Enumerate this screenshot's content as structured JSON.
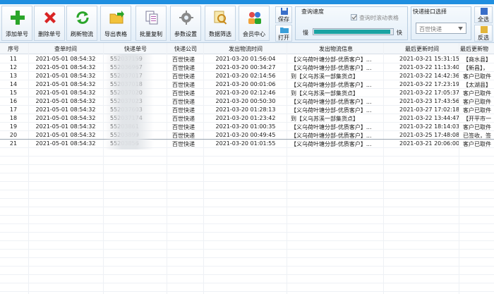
{
  "toolbar": {
    "buttons": [
      {
        "label": "添加单号",
        "icon": "add-icon"
      },
      {
        "label": "删除单号",
        "icon": "delete-icon"
      },
      {
        "label": "刷新物流",
        "icon": "refresh-icon"
      },
      {
        "label": "导出表格",
        "icon": "export-icon"
      },
      {
        "label": "批量复制",
        "icon": "copy-icon"
      },
      {
        "label": "参数设置",
        "icon": "gear-icon"
      },
      {
        "label": "数据筛选",
        "icon": "filter-icon"
      },
      {
        "label": "会员中心",
        "icon": "member-icon"
      }
    ],
    "save_label": "保存",
    "open_label": "打开",
    "speed": {
      "title": "查询速度",
      "auto_scroll_label": "查询时滚动表格",
      "slow_label": "慢",
      "fast_label": "快",
      "value_fraction": 0.97
    },
    "api": {
      "title": "快递接口选择",
      "selected": "百世快递"
    },
    "select_all_label": "全选",
    "invert_label": "反选"
  },
  "table": {
    "columns": [
      "序号",
      "查单时间",
      "快递单号",
      "快递公司",
      "发出物流时间",
      "发出物流信息",
      "最后更新时间",
      "最后更新物"
    ],
    "rows": [
      [
        "11",
        "2021-05-01 08:54:32",
        "552037159",
        "百世快递",
        "2021-03-20 01:56:04",
        "【义乌荷叶塘分部-优质客户】...",
        "2021-03-21 15:31:15",
        "【商水县】"
      ],
      [
        "12",
        "2021-05-01 08:54:32",
        "552036967",
        "百世快递",
        "2021-03-20 00:34:27",
        "【义乌荷叶塘分部-优质客户】...",
        "2021-03-22 11:13:40",
        "【新昌】，"
      ],
      [
        "13",
        "2021-05-01 08:54:32",
        "552037017",
        "百世快递",
        "2021-03-20 02:14:56",
        "到【义乌苏溪一部集货点】",
        "2021-03-22 14:42:36",
        "客户已取件"
      ],
      [
        "14",
        "2021-05-01 08:54:32",
        "552037018",
        "百世快递",
        "2021-03-20 00:01:06",
        "【义乌荷叶塘分部-优质客户】...",
        "2021-03-22 17:23:19",
        "【太湖县】"
      ],
      [
        "15",
        "2021-05-01 08:54:32",
        "552037020",
        "百世快递",
        "2021-03-20 02:12:46",
        "到【义乌苏溪一部集货点】",
        "2021-03-22 17:05:37",
        "客户已取件"
      ],
      [
        "16",
        "2021-05-01 08:54:32",
        "552037023",
        "百世快递",
        "2021-03-20 00:50:30",
        "【义乌荷叶塘分部-优质客户】...",
        "2021-03-23 17:43:56",
        "客户已取件"
      ],
      [
        "17",
        "2021-05-01 08:54:32",
        "552037603",
        "百世快递",
        "2021-03-20 01:28:13",
        "【义乌荷叶塘分部-优质客户】...",
        "2021-03-27 17:02:18",
        "客户已取件"
      ],
      [
        "18",
        "2021-05-01 08:54:32",
        "552037174",
        "百世快递",
        "2021-03-20 01:23:42",
        "到【义乌苏溪一部集货点】",
        "2021-03-22 13:44:47",
        "【开平市一"
      ],
      [
        "19",
        "2021-05-01 08:54:32",
        "55203861",
        "百世快递",
        "2021-03-20 01:00:35",
        "【义乌荷叶塘分部-优质客户】...",
        "2021-03-22 18:14:03",
        "客户已取件"
      ],
      [
        "20",
        "2021-05-01 08:54:32",
        "55203899",
        "百世快递",
        "2021-03-20 00:49:45",
        "【义乌荷叶塘分部-优质客户】...",
        "2021-03-25 17:48:08",
        "已签收，签"
      ],
      [
        "21",
        "2021-05-01 08:54:32",
        "55203856",
        "百世快递",
        "2021-03-20 01:01:55",
        "【义乌荷叶塘分部-优质客户】...",
        "2021-03-21 20:06:00",
        "客户已取件"
      ]
    ]
  },
  "colors": {
    "accent": "#1f8fe0",
    "progress": "#1aa3a3",
    "header_bg": "#f4f7fa"
  }
}
